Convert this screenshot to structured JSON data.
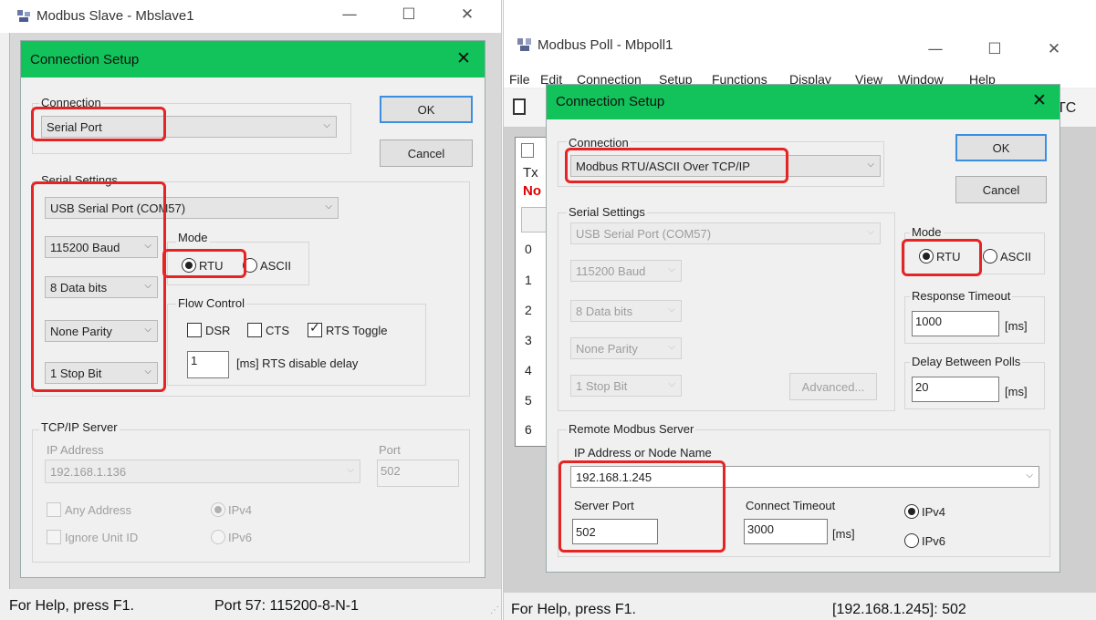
{
  "slave": {
    "title": "Modbus Slave - Mbslave1",
    "status_help": "For Help, press F1.",
    "status_port": "Port 57: 115200-8-N-1",
    "dialog": {
      "title": "Connection Setup",
      "connection_label": "Connection",
      "connection_value": "Serial Port",
      "ok": "OK",
      "cancel": "Cancel",
      "serial_settings_label": "Serial Settings",
      "port": "USB Serial Port (COM57)",
      "baud": "115200 Baud",
      "data_bits": "8 Data bits",
      "parity": "None Parity",
      "stop_bits": "1 Stop Bit",
      "mode_label": "Mode",
      "mode_rtu": "RTU",
      "mode_ascii": "ASCII",
      "flow_control_label": "Flow Control",
      "dsr": "DSR",
      "cts": "CTS",
      "rts_toggle": "RTS Toggle",
      "rts_delay_value": "1",
      "rts_delay_label": "[ms] RTS disable delay",
      "tcp_server_label": "TCP/IP Server",
      "ip_label": "IP Address",
      "ip_value": "192.168.1.136",
      "port_label": "Port",
      "port_value": "502",
      "any_address": "Any Address",
      "ignore_unit_id": "Ignore Unit ID",
      "ipv4": "IPv4",
      "ipv6": "IPv6"
    }
  },
  "poll": {
    "title": "Modbus Poll - Mbpoll1",
    "menu": [
      "File",
      "Edit",
      "Connection",
      "Setup",
      "Functions",
      "Display",
      "View",
      "Window",
      "Help"
    ],
    "toolbar_tail": "TC",
    "child_tx": "Tx",
    "child_no": "No",
    "rows": [
      "0",
      "1",
      "2",
      "3",
      "4",
      "5",
      "6"
    ],
    "status_help": "For Help, press F1.",
    "status_ip": "[192.168.1.245]: 502",
    "dialog": {
      "title": "Connection Setup",
      "connection_label": "Connection",
      "connection_value": "Modbus RTU/ASCII Over TCP/IP",
      "ok": "OK",
      "cancel": "Cancel",
      "serial_settings_label": "Serial Settings",
      "port": "USB Serial Port (COM57)",
      "baud": "115200 Baud",
      "data_bits": "8 Data bits",
      "parity": "None Parity",
      "stop_bits": "1 Stop Bit",
      "advanced": "Advanced...",
      "mode_label": "Mode",
      "mode_rtu": "RTU",
      "mode_ascii": "ASCII",
      "response_timeout_label": "Response Timeout",
      "response_timeout_value": "1000",
      "ms": "[ms]",
      "delay_label": "Delay Between Polls",
      "delay_value": "20",
      "remote_label": "Remote Modbus Server",
      "ip_label": "IP Address or Node Name",
      "ip_value": "192.168.1.245",
      "server_port_label": "Server Port",
      "server_port_value": "502",
      "connect_timeout_label": "Connect Timeout",
      "connect_timeout_value": "3000",
      "ipv4": "IPv4",
      "ipv6": "IPv6"
    }
  },
  "colors": {
    "dialog_title_bg": "#12c25a",
    "highlight": "#e62424",
    "default_button_border": "#3b8ee0"
  }
}
